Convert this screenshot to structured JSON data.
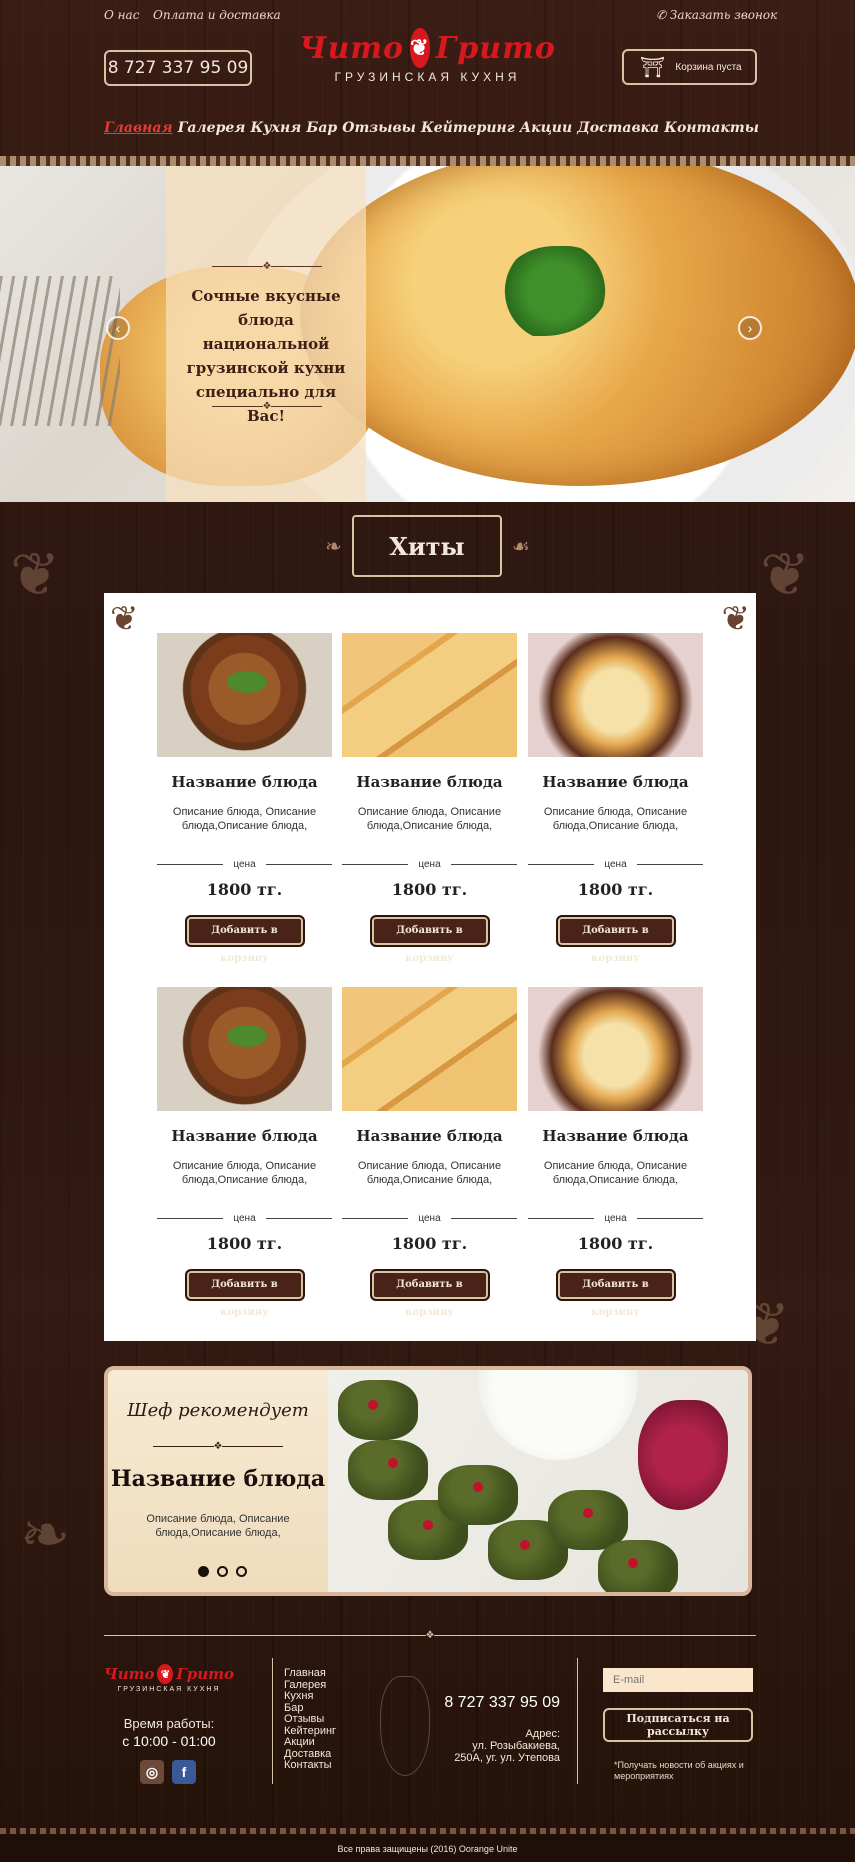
{
  "topbar": {
    "about": "О нас",
    "payment": "Оплата и доставка",
    "callback": "Заказать звонок"
  },
  "header": {
    "phone": "8 727 337 95 09",
    "logo_word1": "Чито",
    "logo_word2": "Грито",
    "logo_sub": "ГРУЗИНСКАЯ КУХНЯ",
    "cart": "Корзина пуста"
  },
  "nav": [
    {
      "label": "Главная",
      "active": true
    },
    {
      "label": "Галерея"
    },
    {
      "label": "Кухня"
    },
    {
      "label": "Бар"
    },
    {
      "label": "Отзывы"
    },
    {
      "label": "Кейтеринг"
    },
    {
      "label": "Акции"
    },
    {
      "label": "Доставка"
    },
    {
      "label": "Контакты"
    }
  ],
  "hero": {
    "text": "Сочные вкусные блюда национальной грузинской кухни специально для Вас!",
    "prev": "‹",
    "next": "›"
  },
  "hits": {
    "title": "Хиты",
    "products": [
      {
        "name": "Название блюда",
        "desc": "Описание блюда, Описание блюда,Описание блюда,",
        "price_label": "цена",
        "price": "1800 тг.",
        "button": "Добавить в корзину",
        "image": "soup"
      },
      {
        "name": "Название блюда",
        "desc": "Описание блюда, Описание блюда,Описание блюда,",
        "price_label": "цена",
        "price": "1800 тг.",
        "button": "Добавить в корзину",
        "image": "khachapuri"
      },
      {
        "name": "Название блюда",
        "desc": "Описание блюда, Описание блюда,Описание блюда,",
        "price_label": "цена",
        "price": "1800 тг.",
        "button": "Добавить в корзину",
        "image": "baked"
      },
      {
        "name": "Название блюда",
        "desc": "Описание блюда, Описание блюда,Описание блюда,",
        "price_label": "цена",
        "price": "1800 тг.",
        "button": "Добавить в корзину",
        "image": "soup"
      },
      {
        "name": "Название блюда",
        "desc": "Описание блюда, Описание блюда,Описание блюда,",
        "price_label": "цена",
        "price": "1800 тг.",
        "button": "Добавить в корзину",
        "image": "khachapuri"
      },
      {
        "name": "Название блюда",
        "desc": "Описание блюда, Описание блюда,Описание блюда,",
        "price_label": "цена",
        "price": "1800 тг.",
        "button": "Добавить в корзину",
        "image": "baked"
      }
    ]
  },
  "chef": {
    "title": "Шеф рекомендует",
    "name": "Название блюда",
    "desc": "Описание блюда, Описание блюда,Описание блюда,",
    "active_dot": 1,
    "dot_count": 3
  },
  "footer": {
    "logo_word1": "Чито",
    "logo_word2": "Грито",
    "logo_sub": "ГРУЗИНСКАЯ КУХНЯ",
    "hours_label": "Время работы:",
    "hours": "с 10:00  - 01:00",
    "menu": [
      "Главная",
      "Галерея",
      "Кухня",
      "Бар",
      "Отзывы",
      "Кейтеринг",
      "Акции",
      "Доставка",
      "Контакты"
    ],
    "phone": "8 727 337 95 09",
    "address_label": "Адрес:",
    "address_line1": "ул. Розыбакиева,",
    "address_line2": "250А, уг. ул. Утепова",
    "email_placeholder": "E-mail",
    "subscribe": "Подписаться на рассылку",
    "note": "*Получать новости об акциях и мероприятиях",
    "copyright": "Все права защищены (2016) Oorange Unite",
    "social_icons": [
      "instagram-icon",
      "facebook-icon"
    ]
  },
  "colors": {
    "accent": "#d7191f",
    "wood": "#2b1610",
    "cream": "#f3e8d8",
    "button": "#4a2318"
  }
}
